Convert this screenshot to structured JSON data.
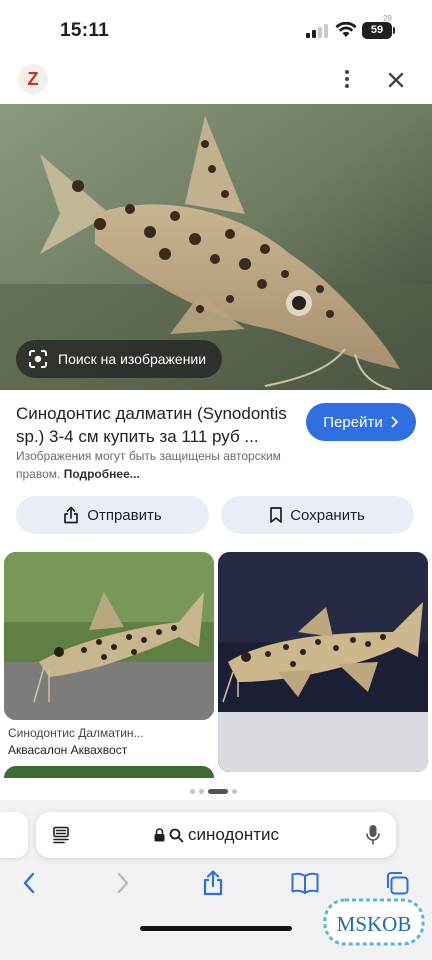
{
  "status_bar": {
    "time": "15:11",
    "battery": "59",
    "battery_small": "29"
  },
  "app_bar": {
    "logo_letter": "Z",
    "more_icon": "more-vert-icon",
    "close_icon": "close-icon"
  },
  "main_image": {
    "lens_label": "Поиск на изображении"
  },
  "result": {
    "title": "Синодонтис далматин (Synodontis sp.) 3-4 см купить за 111 руб ...",
    "visit_label": "Перейти",
    "copyright_text": "Изображения могут быть защищены авторским правом.",
    "more_link": "Подробнее..."
  },
  "actions": {
    "share_label": "Отправить",
    "save_label": "Сохранить"
  },
  "related": [
    {
      "caption": "Синодонтис Далматин...",
      "source": "Аквасалон Аквахвост"
    }
  ],
  "safari": {
    "url": "синодонтис"
  },
  "watermark": "MSKOB",
  "colors": {
    "accent": "#2f6fe0",
    "chip_bg": "#e9eef6",
    "safari_bg": "#f2f2f4"
  }
}
